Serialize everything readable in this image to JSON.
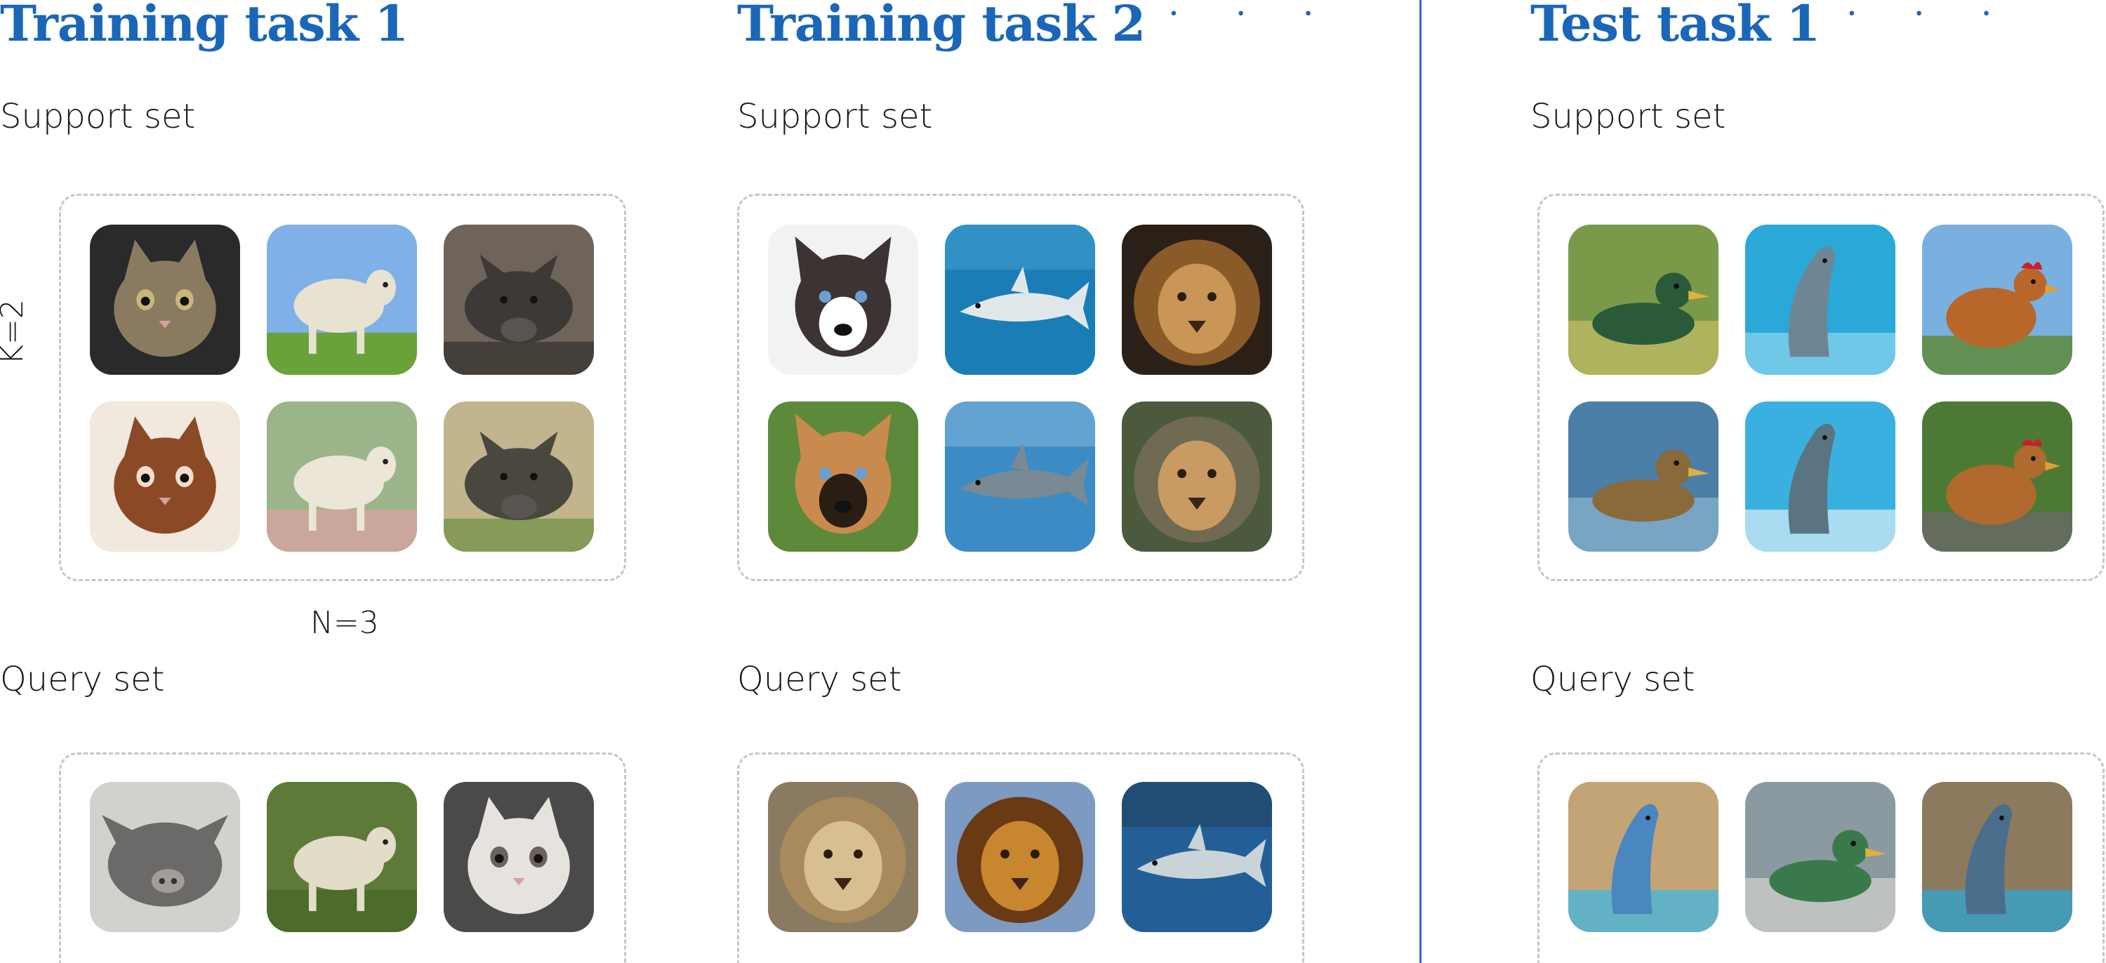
{
  "colors": {
    "title": "#1a66b8",
    "divider": "#2d6fc0",
    "dash": "#c6c6c6"
  },
  "panels": [
    {
      "title": "Training task 1",
      "ellipsis": "",
      "support_label": "Support set",
      "query_label": "Query set",
      "k_label": "K=2",
      "n_label": "N=3",
      "support": [
        {
          "icon": "cat-icon",
          "bg": "#2a2a2a",
          "fg": "#8a7a60",
          "ac": "#c9b77a"
        },
        {
          "icon": "lamb-icon",
          "bg": "#7fb0e8",
          "fg": "#e8e2d0",
          "ac": "#6aa23a"
        },
        {
          "icon": "boar-icon",
          "bg": "#6e6459",
          "fg": "#3c3936",
          "ac": "#2a2724"
        },
        {
          "icon": "cat-icon",
          "bg": "#f1e8de",
          "fg": "#8b4a25",
          "ac": "#f5dccf"
        },
        {
          "icon": "lamb-icon",
          "bg": "#9cb48a",
          "fg": "#ece6d8",
          "ac": "#c9a79a"
        },
        {
          "icon": "warthog-icon",
          "bg": "#c2b48c",
          "fg": "#4a473e",
          "ac": "#5b8a34"
        }
      ],
      "query": [
        {
          "icon": "pig-icon",
          "bg": "#d3d1ce",
          "fg": "#6c6a68",
          "ac": "#a19d99"
        },
        {
          "icon": "lamb-icon",
          "bg": "#5e7a38",
          "fg": "#e2dcc8",
          "ac": "#4d6b2b"
        },
        {
          "icon": "cat-icon",
          "bg": "#4a4a4a",
          "fg": "#e6e2de",
          "ac": "#6c625c"
        }
      ]
    },
    {
      "title": "Training task 2",
      "ellipsis": "· · ·",
      "support_label": "Support set",
      "query_label": "Query set",
      "support": [
        {
          "icon": "husky-icon",
          "bg": "#f2f2f2",
          "fg": "#3b3432",
          "ac": "#ffffff"
        },
        {
          "icon": "shark-icon",
          "bg": "#1b7db6",
          "fg": "#dfe7ea",
          "ac": "#5bb6e0"
        },
        {
          "icon": "lion-icon",
          "bg": "#2a2018",
          "fg": "#c99656",
          "ac": "#8a5a28"
        },
        {
          "icon": "dog-icon",
          "bg": "#5c8a3a",
          "fg": "#c98a4e",
          "ac": "#2a1d14"
        },
        {
          "icon": "shark-icon",
          "bg": "#3d8bc4",
          "fg": "#7a8a95",
          "ac": "#a9d0ec"
        },
        {
          "icon": "lion-icon",
          "bg": "#4b5a3c",
          "fg": "#c99a62",
          "ac": "#6f6a52"
        }
      ],
      "query": [
        {
          "icon": "lion-icon",
          "bg": "#8a7a62",
          "fg": "#d8bf92",
          "ac": "#a88a5c"
        },
        {
          "icon": "lion-icon",
          "bg": "#7d9ac2",
          "fg": "#c8862e",
          "ac": "#6a3a14"
        },
        {
          "icon": "shark-icon",
          "bg": "#235f96",
          "fg": "#c9d3d8",
          "ac": "#1c2a38"
        }
      ]
    },
    {
      "title": "Test task 1",
      "ellipsis": "· · ·",
      "support_label": "Support set",
      "query_label": "Query set",
      "support": [
        {
          "icon": "duck-icon",
          "bg": "#7a9a4a",
          "fg": "#2a5a3a",
          "ac": "#d9c86e"
        },
        {
          "icon": "dolphin-icon",
          "bg": "#2aa8d8",
          "fg": "#6e8694",
          "ac": "#8fd6f0"
        },
        {
          "icon": "chicken-icon",
          "bg": "#79b0e0",
          "fg": "#b8662a",
          "ac": "#5a8a2e"
        },
        {
          "icon": "duck-icon",
          "bg": "#4a7fa8",
          "fg": "#8a6a3a",
          "ac": "#a0c4dc"
        },
        {
          "icon": "dolphin-icon",
          "bg": "#3ab0e0",
          "fg": "#5a7482",
          "ac": "#d8eef8"
        },
        {
          "icon": "chicken-icon",
          "bg": "#4c7a34",
          "fg": "#b06a2e",
          "ac": "#6a6a66"
        }
      ],
      "query": [
        {
          "icon": "dolphin-icon",
          "bg": "#c2a476",
          "fg": "#4a86c0",
          "ac": "#3ab8e6"
        },
        {
          "icon": "duck-icon",
          "bg": "#8a9aa0",
          "fg": "#3a7a4a",
          "ac": "#e8e2d8"
        },
        {
          "icon": "dolphin-icon",
          "bg": "#8c7a5e",
          "fg": "#4a6e8c",
          "ac": "#2aa8d8"
        }
      ]
    }
  ]
}
